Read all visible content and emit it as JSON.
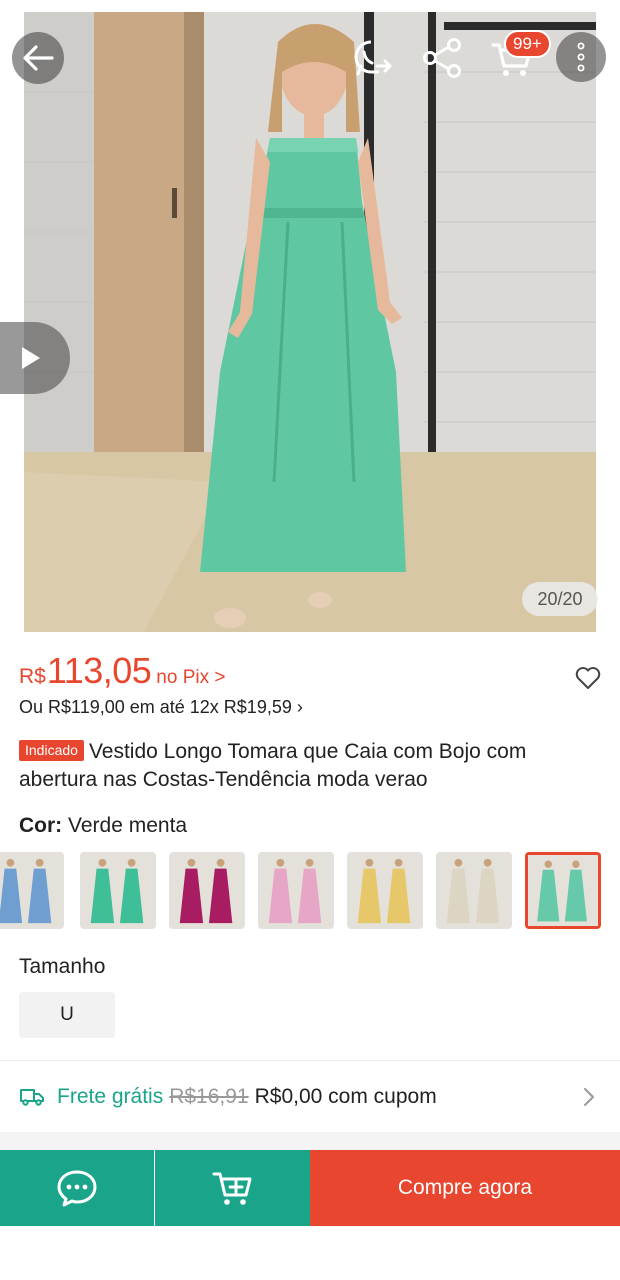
{
  "header": {
    "back_icon": "arrow-left-icon",
    "whatsapp_icon": "whatsapp-share-icon",
    "share_icon": "share-icon",
    "cart_icon": "cart-icon",
    "cart_badge": "99+",
    "more_icon": "more-vertical-icon"
  },
  "gallery": {
    "counter": "20/20",
    "video_icon": "play-icon"
  },
  "price": {
    "currency": "R$",
    "value": "113,05",
    "pix_label": "no Pix >",
    "installments": "Ou R$119,00 em até 12x R$19,59 ›"
  },
  "product": {
    "tag": "Indicado",
    "title": "Vestido Longo Tomara que Caia com Bojo com abertura nas Costas-Tendência moda verao"
  },
  "color": {
    "label": "Cor:",
    "selected": "Verde menta",
    "swatches": [
      {
        "color": "#6f9fd0",
        "selected": false
      },
      {
        "color": "#3fbf98",
        "selected": false
      },
      {
        "color": "#a81c62",
        "selected": false
      },
      {
        "color": "#e7a6c6",
        "selected": false
      },
      {
        "color": "#e6c86a",
        "selected": false
      },
      {
        "color": "#dcd5c4",
        "selected": false
      },
      {
        "color": "#66c9a9",
        "selected": true
      }
    ]
  },
  "size": {
    "label": "Tamanho",
    "options": [
      "U"
    ]
  },
  "shipping": {
    "free_label": "Frete grátis",
    "old_price": "R$16,91",
    "new_price": "R$0,00 com cupom"
  },
  "bottom_bar": {
    "buy_label": "Compre agora"
  },
  "colors": {
    "accent": "#e8462e",
    "brand_green": "#1aa58a"
  }
}
